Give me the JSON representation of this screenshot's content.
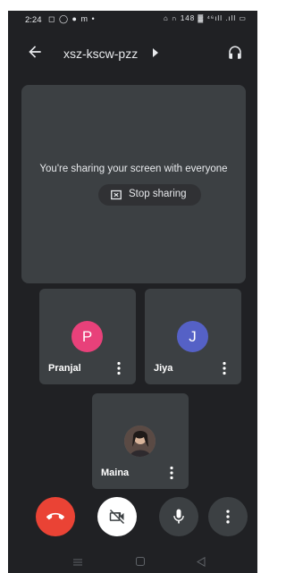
{
  "status_bar": {
    "time": "2:24",
    "left_icons": "◻ ◯ ● m •",
    "right_icons": "⌂ ∩ 148 ▓ ⁴⁶ıll .ıll ▭"
  },
  "header": {
    "meeting_code": "xsz-kscw-pzz"
  },
  "share": {
    "message": "You're sharing your screen with everyone",
    "stop_label": "Stop sharing"
  },
  "participants": [
    {
      "name": "Pranjal",
      "initial": "P",
      "avatar_color": "#e8417a"
    },
    {
      "name": "Jiya",
      "initial": "J",
      "avatar_color": "#5561c6"
    },
    {
      "name": "Maina",
      "initial": "",
      "avatar_color": "#6b6b6b"
    }
  ],
  "controls": [
    {
      "icon": "end-call-icon",
      "color": "#ea4335"
    },
    {
      "icon": "camera-off-icon",
      "color": "#ffffff"
    },
    {
      "icon": "mic-icon",
      "color": "#3c4043"
    },
    {
      "icon": "more-vert-icon",
      "color": "#3c4043"
    }
  ],
  "colors": {
    "background": "#202124",
    "surface": "#3c4043",
    "text": "#e8eaed"
  }
}
